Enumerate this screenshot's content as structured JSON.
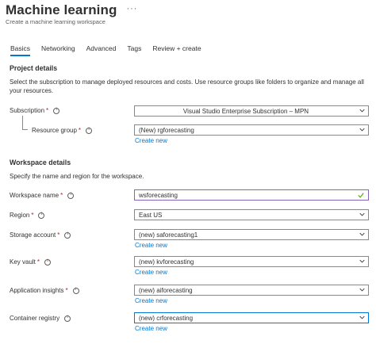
{
  "header": {
    "title": "Machine learning",
    "more": "···",
    "subtitle": "Create a machine learning workspace"
  },
  "tabs": [
    {
      "label": "Basics",
      "active": true
    },
    {
      "label": "Networking",
      "active": false
    },
    {
      "label": "Advanced",
      "active": false
    },
    {
      "label": "Tags",
      "active": false
    },
    {
      "label": "Review + create",
      "active": false
    }
  ],
  "project": {
    "title": "Project details",
    "description": "Select the subscription to manage deployed resources and costs. Use resource groups like folders to organize and manage all your resources.",
    "subscription": {
      "label": "Subscription",
      "required": "*",
      "value": "Visual Studio Enterprise Subscription – MPN"
    },
    "resource_group": {
      "label": "Resource group",
      "required": "*",
      "value": "(New) rgforecasting",
      "create_new": "Create new"
    }
  },
  "workspace": {
    "title": "Workspace details",
    "description": "Specify the name and region for the workspace.",
    "name": {
      "label": "Workspace name",
      "required": "*",
      "value": "wsforecasting"
    },
    "region": {
      "label": "Region",
      "required": "*",
      "value": "East US"
    },
    "storage": {
      "label": "Storage account",
      "required": "*",
      "value": "(new) saforecasting1",
      "create_new": "Create new"
    },
    "keyvault": {
      "label": "Key vault",
      "required": "*",
      "value": "(new) kvforecasting",
      "create_new": "Create new"
    },
    "insights": {
      "label": "Application insights",
      "required": "*",
      "value": "(new) aiforecasting",
      "create_new": "Create new"
    },
    "registry": {
      "label": "Container registry",
      "value": "(new) crforecasting",
      "create_new": "Create new"
    }
  },
  "colors": {
    "accent": "#0078d4",
    "required": "#a4262c",
    "valid": "#57a300",
    "input_border": "#8764b8"
  }
}
